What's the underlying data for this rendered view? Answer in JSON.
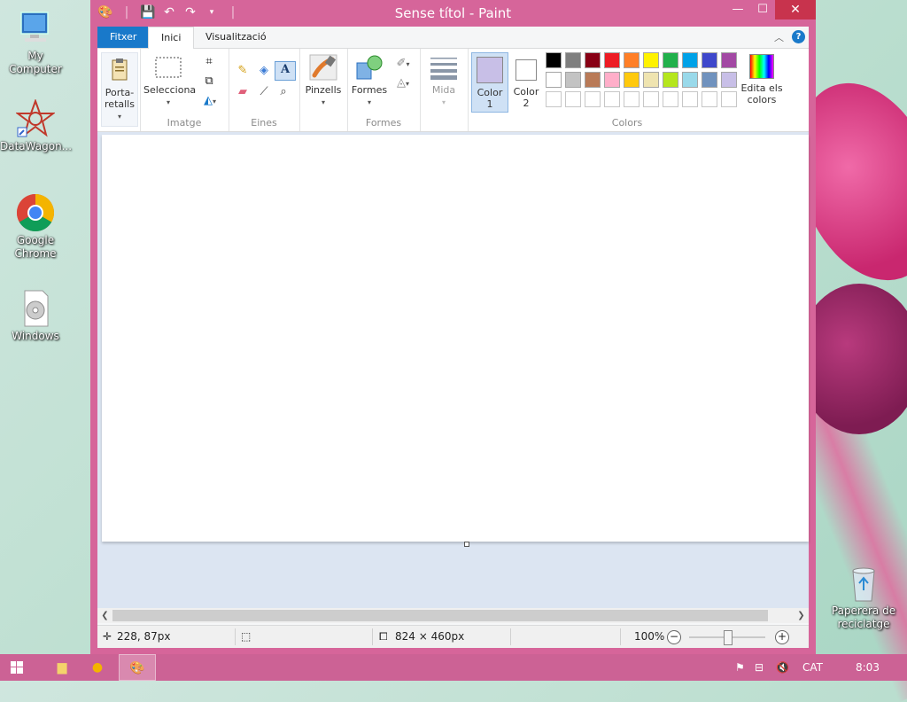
{
  "desktop": {
    "icons": [
      {
        "label": "My Computer",
        "icon": "computer-icon"
      },
      {
        "label": "DataWagon...",
        "icon": "datawagon-icon"
      },
      {
        "label": "Google Chrome",
        "icon": "chrome-icon"
      },
      {
        "label": "Windows",
        "icon": "disc-file-icon"
      },
      {
        "label": "Paperera de reciclatge",
        "icon": "recycle-bin-icon"
      }
    ]
  },
  "window": {
    "title": "Sense títol - Paint",
    "controls": {
      "minimize": "—",
      "maximize": "☐",
      "close": "✕"
    }
  },
  "ribbon": {
    "tabs": [
      "Fitxer",
      "Inici",
      "Visualització"
    ],
    "groups": {
      "clipboard": {
        "label": "Porta-\nretalls",
        "button": "Porta-retalls"
      },
      "image": {
        "label": "Imatge",
        "select": "Selecciona"
      },
      "tools": {
        "label": "Eines"
      },
      "brushes": {
        "button": "Pinzells"
      },
      "shapes": {
        "label": "Formes",
        "button": "Formes"
      },
      "size": {
        "button": "Mida"
      },
      "colors": {
        "label": "Colors",
        "color1": "Color",
        "color1_num": "1",
        "color2": "Color",
        "color2_num": "2",
        "edit_line1": "Edita els",
        "edit_line2": "colors",
        "color1_value": "#c8bfe7",
        "color2_value": "#ffffff",
        "palette_row1": [
          "#000000",
          "#7f7f7f",
          "#880015",
          "#ed1c24",
          "#ff7f27",
          "#fff200",
          "#22b14c",
          "#00a2e8",
          "#3f48cc",
          "#a349a4"
        ],
        "palette_row2": [
          "#ffffff",
          "#c3c3c3",
          "#b97a57",
          "#ffaec9",
          "#ffc90e",
          "#efe4b0",
          "#b5e61d",
          "#99d9ea",
          "#7092be",
          "#c8bfe7"
        ]
      }
    }
  },
  "status": {
    "cursor_pos": "228, 87px",
    "canvas_size": "824 × 460px",
    "zoom": "100%",
    "zoom_level": 0.5
  },
  "taskbar": {
    "language": "CAT",
    "time": "8:03"
  },
  "colors": {
    "accent": "#d6659a",
    "file_tab": "#1979ca",
    "taskbar": "#cc6295"
  }
}
